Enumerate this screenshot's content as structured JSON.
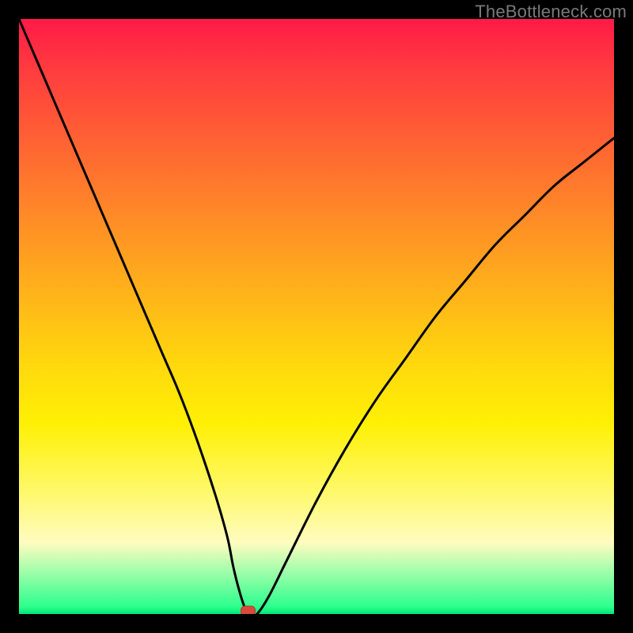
{
  "watermark": "TheBottleneck.com",
  "colors": {
    "frame": "#000000",
    "curve": "#000000",
    "marker_fill": "#d84b3a",
    "marker_stroke": "#b33a2e",
    "gradient_stops": [
      "#ff1a47",
      "#ff3a3f",
      "#ff5a36",
      "#ff7a2c",
      "#ff9a22",
      "#ffb918",
      "#ffd80e",
      "#fff004",
      "#fff970",
      "#fffcc0",
      "#2cff8e",
      "#00e676"
    ]
  },
  "chart_data": {
    "type": "line",
    "title": "",
    "xlabel": "",
    "ylabel": "",
    "xlim": [
      0,
      100
    ],
    "ylim": [
      0,
      100
    ],
    "series": [
      {
        "name": "bottleneck-curve",
        "x": [
          0,
          3,
          6,
          9,
          12,
          15,
          18,
          21,
          24,
          27,
          30,
          33,
          35,
          36,
          37,
          38,
          39,
          40,
          42,
          45,
          50,
          55,
          60,
          65,
          70,
          75,
          80,
          85,
          90,
          95,
          100
        ],
        "y": [
          100,
          93,
          86,
          79,
          72,
          65,
          58,
          51,
          44,
          37,
          29,
          20,
          13,
          8,
          4,
          1,
          0,
          0,
          3,
          9,
          19,
          28,
          36,
          43,
          50,
          56,
          62,
          67,
          72,
          76,
          80
        ]
      }
    ],
    "annotations": [
      {
        "name": "optimal-marker",
        "x": 38.5,
        "y": 0,
        "shape": "rounded-rect"
      }
    ],
    "grid": false,
    "legend": false
  }
}
